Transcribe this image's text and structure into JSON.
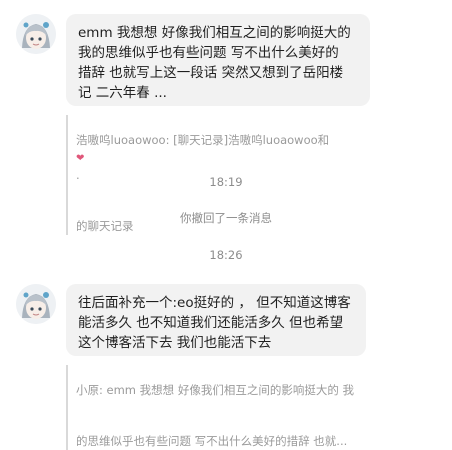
{
  "messages": [
    {
      "text": "emm 我想想 好像我们相互之间的影响挺大的\n我的思维似乎也有些问题 写不出什么美好的\n措辞 也就写上这一段话 突然又想到了岳阳楼\n记 二六年春 ...",
      "quote": {
        "line1": "浩嗷呜luoaowoo: [聊天记录]浩嗷呜luoaowoo和",
        "line1_suffix": ".",
        "line2": "的聊天记录"
      }
    },
    {
      "text": "往后面补充一个:eo挺好的 ， 但不知道这博客\n能活多久 也不知道我们还能活多久 但也希望\n这个博客活下去 我们也能活下去",
      "quote": {
        "line1": "小原: emm 我想想 好像我们相互之间的影响挺大的 我",
        "line2": "的思维似乎也有些问题 写不出什么美好的措辞 也就..."
      }
    }
  ],
  "system": {
    "time1": "18:19",
    "recall": "你撤回了一条消息",
    "time2": "18:26"
  },
  "colors": {
    "bubble": "#f2f2f2",
    "system_text": "#8c8c8c",
    "quote_text": "#9a9a9a"
  },
  "icons": {
    "avatar": "anime-avatar-icon",
    "heart": "heart-icon"
  }
}
